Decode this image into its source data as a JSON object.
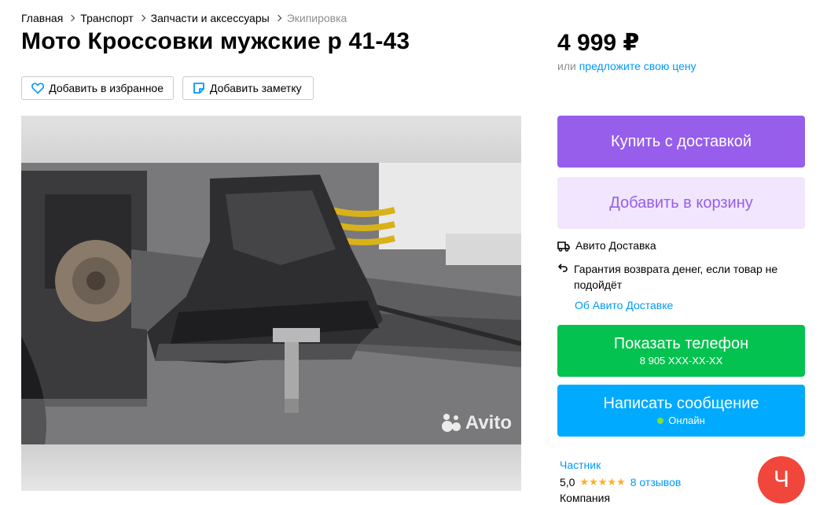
{
  "breadcrumbs": [
    "Главная",
    "Транспорт",
    "Запчасти и аксессуары",
    "Экипировка"
  ],
  "title": "Мото Кроссовки мужские р 41-43",
  "actions": {
    "favorite_label": "Добавить в избранное",
    "note_label": "Добавить заметку"
  },
  "gallery": {
    "watermark": "Avito"
  },
  "price": {
    "value": "4 999 ₽",
    "offer_prefix": "или",
    "offer_link": "предложите свою цену"
  },
  "buttons": {
    "buy": "Купить с доставкой",
    "cart": "Добавить в корзину",
    "phone": "Показать телефон",
    "phone_number": "8 905 XXX-XX-XX",
    "message": "Написать сообщение",
    "online": "Онлайн"
  },
  "delivery": {
    "service": "Авито Доставка",
    "guarantee": "Гарантия возврата денег, если товар не подойдёт",
    "about_link": "Об Авито Доставке"
  },
  "seller": {
    "type": "Частник",
    "rating": "5,0",
    "stars": "★★★★★",
    "reviews": "8 отзывов",
    "kind": "Компания",
    "avatar_letter": "Ч"
  },
  "colors": {
    "purple": "#965eeb",
    "purple_light": "#f1e6fd",
    "green": "#04c24f",
    "blue": "#00aaff",
    "link": "#0099f7",
    "avatar": "#f0463c",
    "star": "#ffb021"
  }
}
